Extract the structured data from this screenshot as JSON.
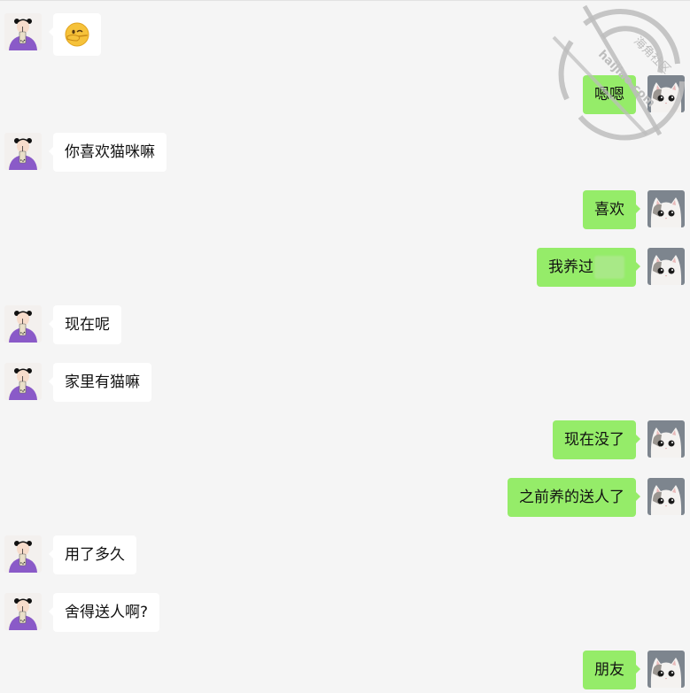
{
  "colors": {
    "background": "#f5f5f5",
    "incoming_bubble": "#ffffff",
    "outgoing_bubble": "#95ec69",
    "girl_shirt": "#8a5ac8",
    "watermark": "#bdbdbd"
  },
  "avatars": {
    "incoming": "girl-drinking-bubble-tea-avatar",
    "outgoing": "white-cat-avatar"
  },
  "watermark": {
    "text_cn": "海角社区",
    "text_en": "haijiao.com"
  },
  "messages": [
    {
      "sender": "incoming",
      "type": "emoji",
      "emoji": "🫵",
      "icon": "pointing-emoji-icon"
    },
    {
      "sender": "outgoing",
      "type": "text",
      "text": "嗯嗯"
    },
    {
      "sender": "incoming",
      "type": "text",
      "text": "你喜欢猫咪嘛"
    },
    {
      "sender": "outgoing",
      "type": "text",
      "text": "喜欢"
    },
    {
      "sender": "outgoing",
      "type": "text",
      "text": "我养过",
      "redacted": true
    },
    {
      "sender": "incoming",
      "type": "text",
      "text": "现在呢"
    },
    {
      "sender": "incoming",
      "type": "text",
      "text": "家里有猫嘛"
    },
    {
      "sender": "outgoing",
      "type": "text",
      "text": "现在没了"
    },
    {
      "sender": "outgoing",
      "type": "text",
      "text": "之前养的送人了"
    },
    {
      "sender": "incoming",
      "type": "text",
      "text": "用了多久"
    },
    {
      "sender": "incoming",
      "type": "text",
      "text": "舍得送人啊?"
    },
    {
      "sender": "outgoing",
      "type": "text",
      "text": "朋友"
    }
  ]
}
